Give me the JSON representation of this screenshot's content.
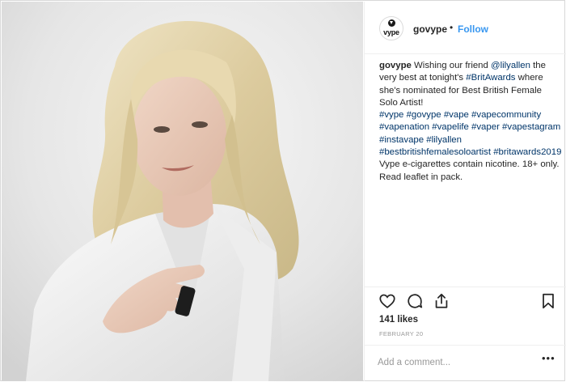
{
  "post": {
    "username": "govype",
    "separator": "•",
    "follow_label": "Follow",
    "avatar_text": "vype",
    "caption": {
      "username": "govype",
      "parts": [
        {
          "t": " Wishing our friend ",
          "tag": false
        },
        {
          "t": "@lilyallen",
          "tag": true
        },
        {
          "t": " the very best at tonight's ",
          "tag": false
        },
        {
          "t": "#BritAwards",
          "tag": true
        },
        {
          "t": " where she's nominated for Best British Female Solo Artist!",
          "tag": false
        },
        {
          "br": true
        },
        {
          "t": "#vype",
          "tag": true
        },
        {
          "t": " ",
          "tag": false
        },
        {
          "t": "#govype",
          "tag": true
        },
        {
          "t": " ",
          "tag": false
        },
        {
          "t": "#vape",
          "tag": true
        },
        {
          "t": " ",
          "tag": false
        },
        {
          "t": "#vapecommunity",
          "tag": true
        },
        {
          "t": " ",
          "tag": false
        },
        {
          "t": "#vapenation",
          "tag": true
        },
        {
          "t": " ",
          "tag": false
        },
        {
          "t": "#vapelife",
          "tag": true
        },
        {
          "t": " ",
          "tag": false
        },
        {
          "t": "#vaper",
          "tag": true
        },
        {
          "t": " ",
          "tag": false
        },
        {
          "t": "#vapestagram",
          "tag": true
        },
        {
          "t": " ",
          "tag": false
        },
        {
          "t": "#instavape",
          "tag": true
        },
        {
          "t": " ",
          "tag": false
        },
        {
          "t": "#lilyallen",
          "tag": true
        },
        {
          "t": " ",
          "tag": false
        },
        {
          "t": "#bestbritishfemalesoloartist",
          "tag": true
        },
        {
          "t": " ",
          "tag": false
        },
        {
          "t": "#britawards2019",
          "tag": true
        },
        {
          "br": true
        },
        {
          "t": "Vype e-cigarettes contain nicotine. 18+ only. Read leaflet in pack.",
          "tag": false
        }
      ]
    },
    "likes": "141 likes",
    "date": "FEBRUARY 20",
    "comment_placeholder": "Add a comment...",
    "more_label": "•••",
    "icons": [
      "heart-icon",
      "comment-icon",
      "share-icon",
      "bookmark-icon"
    ]
  },
  "colors": {
    "link": "#3897f0",
    "hashtag": "#003569",
    "text": "#262626",
    "muted": "#999999",
    "border": "#efefef"
  }
}
